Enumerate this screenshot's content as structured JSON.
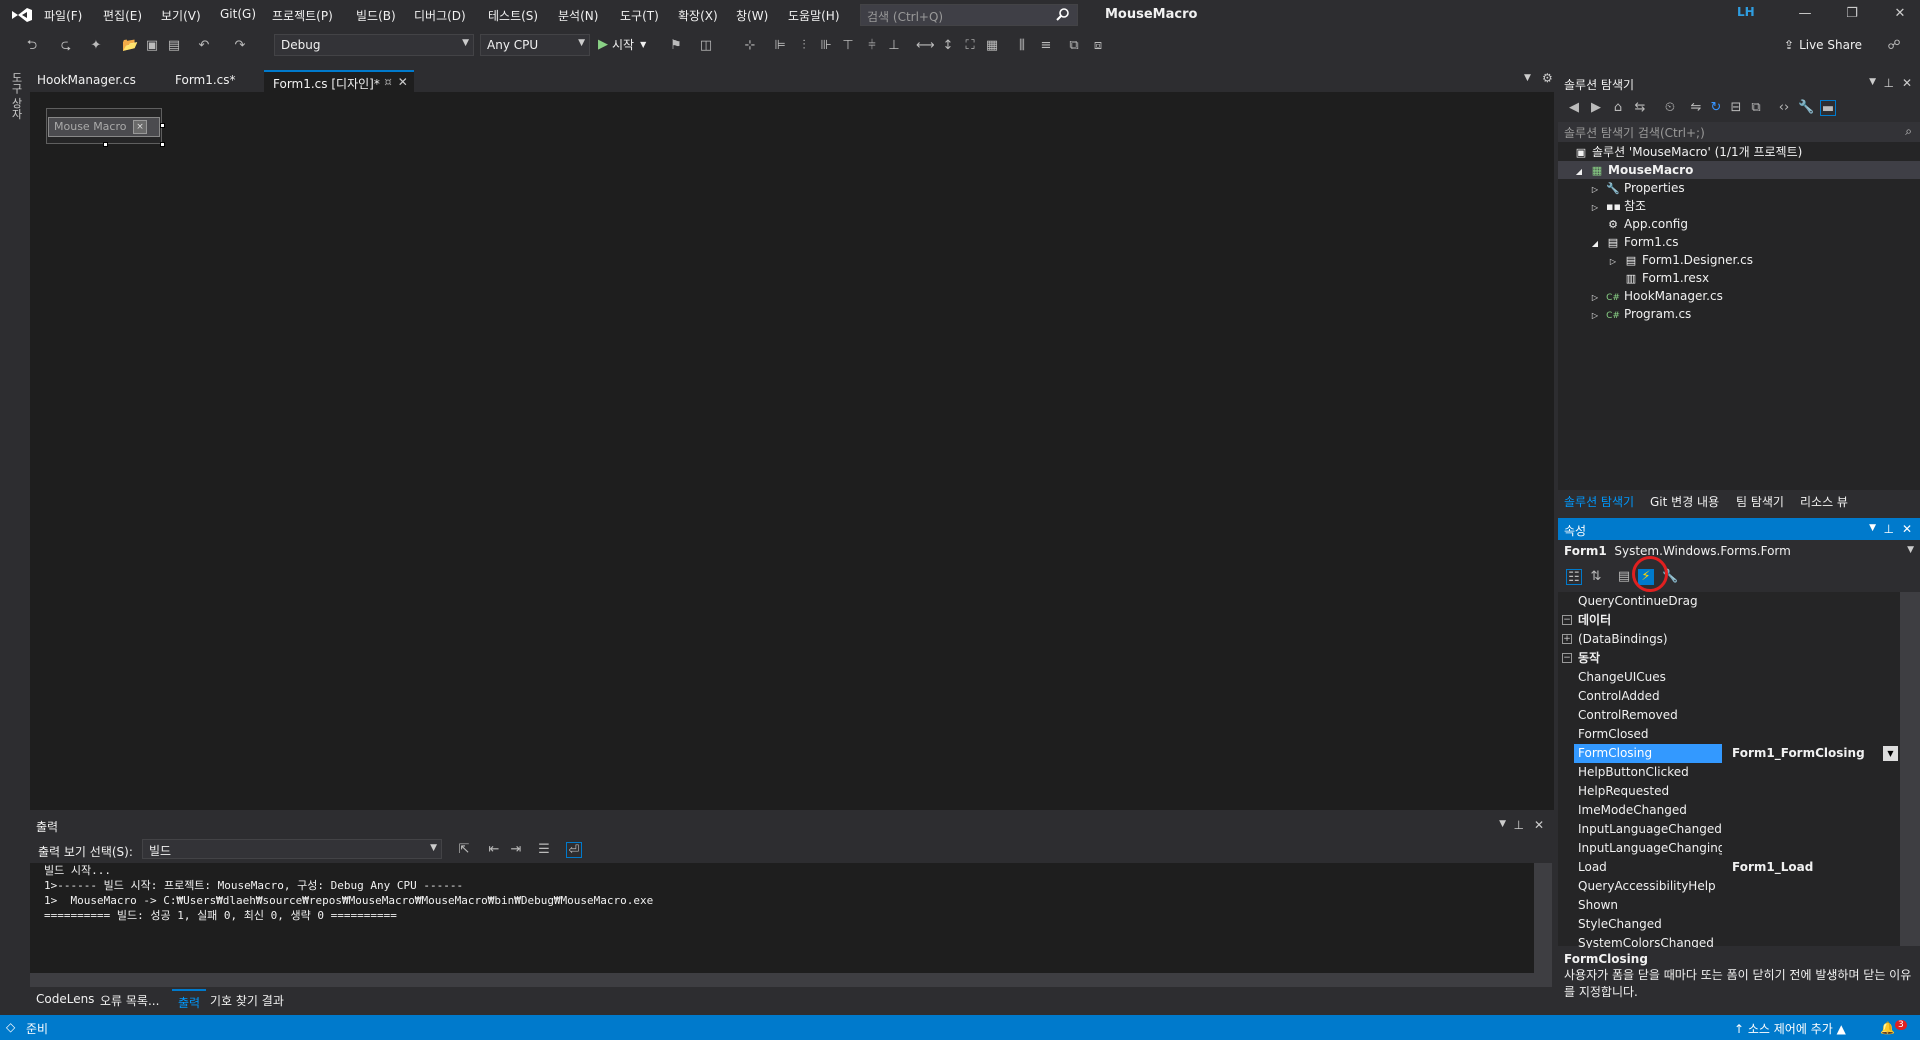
{
  "menu": [
    "파일(F)",
    "편집(E)",
    "보기(V)",
    "Git(G)",
    "프로젝트(P)",
    "빌드(B)",
    "디버그(D)",
    "테스트(S)",
    "분석(N)",
    "도구(T)",
    "확장(X)",
    "창(W)",
    "도움말(H)"
  ],
  "search": {
    "placeholder": "검색 (Ctrl+Q)"
  },
  "app_title": "MouseMacro",
  "user_initials": "LH",
  "toolbar": {
    "config": "Debug",
    "platform": "Any CPU",
    "start_label": "시작",
    "live_share": "Live Share"
  },
  "left_strip": {
    "toolbox": "도구 상자"
  },
  "doc_tabs": [
    "HookManager.cs",
    "Form1.cs*",
    "Form1.cs [디자인]*"
  ],
  "form": {
    "title": "Mouse Macro",
    "close": "×"
  },
  "output": {
    "title": "출력",
    "show_label": "출력 보기 선택(S):",
    "show_value": "빌드",
    "lines": [
      "빌드 시작...",
      "1>------ 빌드 시작: 프로젝트: MouseMacro, 구성: Debug Any CPU ------",
      "1>  MouseMacro -> C:₩Users₩dlaeh₩source₩repos₩MouseMacro₩MouseMacro₩bin₩Debug₩MouseMacro.exe",
      "========== 빌드: 성공 1, 실패 0, 최신 0, 생략 0 =========="
    ]
  },
  "bottom_tabs": [
    "CodeLens",
    "오류 목록...",
    "출력",
    "기호 찾기 결과"
  ],
  "solution_explorer": {
    "title": "솔루션 탐색기",
    "search_placeholder": "솔루션 탐색기 검색(Ctrl+;)",
    "items": [
      {
        "label": "솔루션 'MouseMacro' (1/1개 프로젝트)",
        "icon": "solution-icon"
      },
      {
        "label": "MouseMacro",
        "icon": "csproject-icon"
      },
      {
        "label": "Properties",
        "icon": "wrench-icon"
      },
      {
        "label": "참조",
        "icon": "references-icon"
      },
      {
        "label": "App.config",
        "icon": "config-file-icon"
      },
      {
        "label": "Form1.cs",
        "icon": "form-icon"
      },
      {
        "label": "Form1.Designer.cs",
        "icon": "form-icon"
      },
      {
        "label": "Form1.resx",
        "icon": "resx-icon"
      },
      {
        "label": "HookManager.cs",
        "icon": "csharp-file-icon"
      },
      {
        "label": "Program.cs",
        "icon": "csharp-file-icon"
      }
    ],
    "tabs": [
      "솔루션 탐색기",
      "Git 변경 내용",
      "팀 탐색기",
      "리소스 뷰"
    ]
  },
  "properties": {
    "title": "속성",
    "object_name": "Form1",
    "object_type": "System.Windows.Forms.Form",
    "rows": [
      {
        "name": "QueryContinueDrag",
        "value": ""
      },
      {
        "name": "데이터",
        "value": "",
        "category": true
      },
      {
        "name": "(DataBindings)",
        "value": "",
        "expandable": true
      },
      {
        "name": "동작",
        "value": "",
        "category": true
      },
      {
        "name": "ChangeUICues",
        "value": ""
      },
      {
        "name": "ControlAdded",
        "value": ""
      },
      {
        "name": "ControlRemoved",
        "value": ""
      },
      {
        "name": "FormClosed",
        "value": ""
      },
      {
        "name": "FormClosing",
        "value": "Form1_FormClosing",
        "selected": true
      },
      {
        "name": "HelpButtonClicked",
        "value": ""
      },
      {
        "name": "HelpRequested",
        "value": ""
      },
      {
        "name": "ImeModeChanged",
        "value": ""
      },
      {
        "name": "InputLanguageChanged",
        "value": ""
      },
      {
        "name": "InputLanguageChanging",
        "value": ""
      },
      {
        "name": "Load",
        "value": "Form1_Load"
      },
      {
        "name": "QueryAccessibilityHelp",
        "value": ""
      },
      {
        "name": "Shown",
        "value": ""
      },
      {
        "name": "StyleChanged",
        "value": ""
      },
      {
        "name": "SystemColorsChanged",
        "value": ""
      }
    ],
    "desc_title": "FormClosing",
    "desc_text": "사용자가 폼을 닫을 때마다 또는 폼이 닫히기 전에 발생하며 닫는 이유를 지정합니다."
  },
  "status": {
    "ready": "준비",
    "source_control": "소스 제어에 추가",
    "notifications": "3"
  },
  "colors": {
    "accent": "#007acc",
    "highlight_circle": "#e02020"
  }
}
